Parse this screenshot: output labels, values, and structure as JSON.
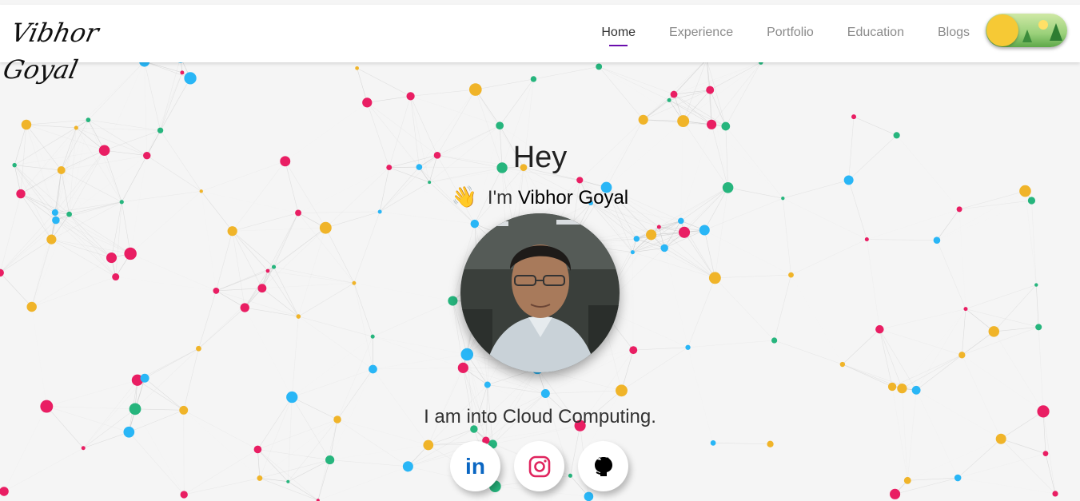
{
  "nav": {
    "logo_text": "Vibhor Goyal",
    "links": [
      {
        "label": "Home",
        "active": true
      },
      {
        "label": "Experience",
        "active": false
      },
      {
        "label": "Portfolio",
        "active": false
      },
      {
        "label": "Education",
        "active": false
      },
      {
        "label": "Blogs",
        "active": false
      }
    ],
    "active_underline_color": "#6a0dad",
    "theme_toggle": {
      "state": "light",
      "knob_color": "#f6c935"
    }
  },
  "hero": {
    "greeting": "Hey",
    "intro_prefix": "I'm",
    "name": "Vibhor Goyal",
    "wave_emoji": "👋",
    "tagline": "I am into Cloud Computing.",
    "avatar_alt": "profile-photo"
  },
  "socials": [
    {
      "name": "linkedin",
      "label": "in",
      "color": "#0a66c2"
    },
    {
      "name": "instagram",
      "icon": "instagram-icon",
      "color": "#e1306c"
    },
    {
      "name": "github",
      "icon": "github-icon",
      "color": "#000000"
    }
  ],
  "colors": {
    "particle_colors": [
      "#e91e63",
      "#26b57d",
      "#f0b429",
      "#29b6f6"
    ],
    "background": "#f5f5f5"
  }
}
